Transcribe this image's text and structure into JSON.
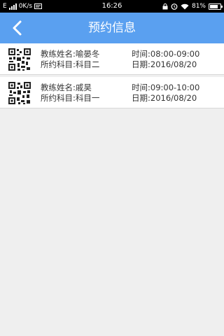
{
  "status_bar": {
    "network_speed": "0K/s",
    "time": "16:26",
    "battery": "81%",
    "icons": [
      "sim-icon",
      "signal-icon",
      "sms-icon",
      "lock-icon",
      "alarm-icon",
      "wifi-icon",
      "battery-icon"
    ]
  },
  "header": {
    "title": "预约信息",
    "back_icon": "chevron-left-icon"
  },
  "appointments": [
    {
      "coach": "教练姓名:喻晏冬",
      "subject": "所约科目:科目二",
      "time": "时间:08:00-09:00",
      "date": "日期:2016/08/20"
    },
    {
      "coach": "教练姓名:戚昊",
      "subject": "所约科目:科目一",
      "time": "时间:09:00-10:00",
      "date": "日期:2016/08/20"
    }
  ],
  "colors": {
    "navbar": "#5aa0f0",
    "background": "#efefef",
    "statusbar": "#000000"
  }
}
